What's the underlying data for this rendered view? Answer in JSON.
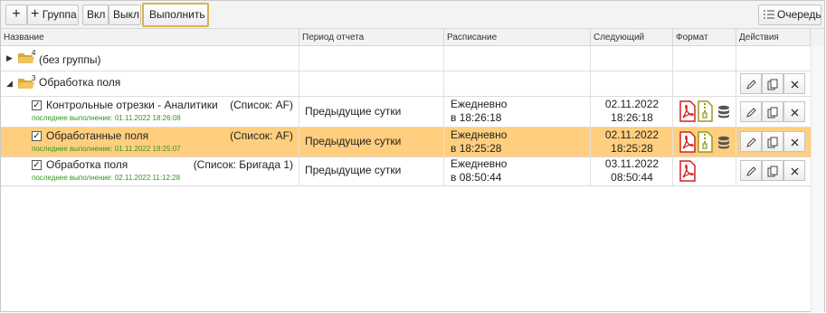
{
  "toolbar": {
    "add_label": "+",
    "add_group_label": "Группа",
    "enable_label": "Вкл",
    "disable_label": "Выкл",
    "run_label": "Выполнить",
    "queue_label": "Очередь"
  },
  "columns": {
    "name": "Название",
    "period": "Период отчета",
    "schedule": "Расписание",
    "next": "Следующий",
    "format": "Формат",
    "actions": "Действия"
  },
  "groups": [
    {
      "label": "(без группы)",
      "count": "4"
    },
    {
      "label": "Обработка поля",
      "count": "3"
    }
  ],
  "reports": [
    {
      "name": "Контрольные отрезки - Аналитики",
      "list": "(Список: AF)",
      "last_run": "последнее выполнение: 01.11.2022 18:26:08",
      "period": "Предыдущие сутки",
      "schedule_line1": "Ежедневно",
      "schedule_line2": "в 18:26:18",
      "next_date": "02.11.2022",
      "next_time": "18:26:18",
      "formats": [
        "pdf-icon",
        "archive-icon",
        "database-icon"
      ],
      "checked": true
    },
    {
      "name": "Обработанные поля",
      "list": "(Список: AF)",
      "last_run": "последнее выполнение: 01.11.2022 18:25:07",
      "period": "Предыдущие сутки",
      "schedule_line1": "Ежедневно",
      "schedule_line2": "в 18:25:28",
      "next_date": "02.11.2022",
      "next_time": "18:25:28",
      "formats": [
        "pdf-icon",
        "archive-icon",
        "database-icon"
      ],
      "checked": true,
      "selected": true
    },
    {
      "name": "Обработка поля",
      "list": "(Список: Бригада 1)",
      "last_run": "последнее выполнение: 02.11.2022 11:12:28",
      "period": "Предыдущие сутки",
      "schedule_line1": "Ежедневно",
      "schedule_line2": "в 08:50:44",
      "next_date": "03.11.2022",
      "next_time": "08:50:44",
      "formats": [
        "pdf-icon"
      ],
      "checked": true
    }
  ],
  "colors": {
    "selected_row": "#ffcf7f",
    "highlight_border": "#d9b44a",
    "last_run_text": "#2e9a1c",
    "pdf_red": "#d42020",
    "archive_olive": "#9a9a1c",
    "folder_yellow": "#e7b84c"
  }
}
